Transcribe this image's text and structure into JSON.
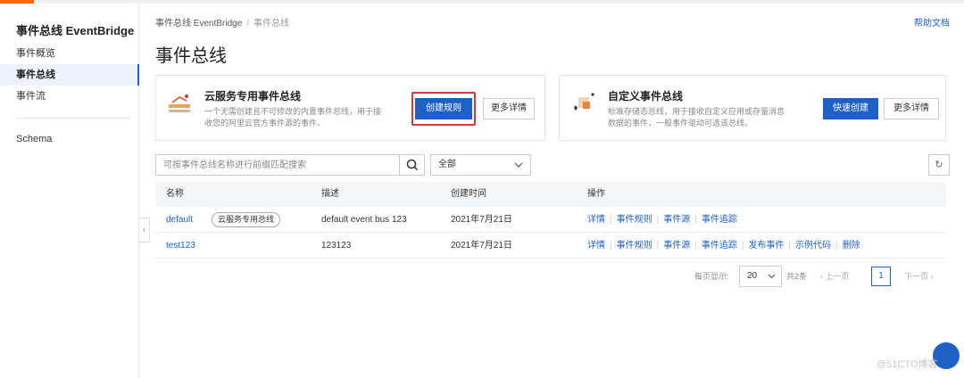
{
  "sidebar": {
    "title": "事件总线 EventBridge",
    "items": [
      {
        "label": "事件概览"
      },
      {
        "label": "事件总线"
      },
      {
        "label": "事件流"
      },
      {
        "label": "Schema"
      }
    ]
  },
  "header": {
    "breadcrumb": [
      "事件总线 EventBridge",
      "事件总线"
    ],
    "help": "帮助文档",
    "page_title": "事件总线"
  },
  "cards": [
    {
      "title": "云服务专用事件总线",
      "desc": "一个无需创建且不可修改的内置事件总线，用于接收您的阿里云官方事件源的事件。",
      "primary": "创建规则",
      "secondary": "更多详情"
    },
    {
      "title": "自定义事件总线",
      "desc": "标准存储态总线，用于接收自定义应用或存量消息数据的事件，一般事件驱动可选该总线。",
      "primary": "快速创建",
      "secondary": "更多详情"
    }
  ],
  "filter": {
    "search_placeholder": "可按事件总线名称进行前缀匹配搜索",
    "select_value": "全部"
  },
  "table": {
    "headers": [
      "名称",
      "描述",
      "创建时间",
      "操作"
    ],
    "rows": [
      {
        "name": "default",
        "tag": "云服务专用总线",
        "desc": "default event bus 123",
        "created": "2021年7月21日",
        "ops": [
          "详情",
          "事件规则",
          "事件源",
          "事件追踪"
        ]
      },
      {
        "name": "test123",
        "tag": "",
        "desc": "123123",
        "created": "2021年7月21日",
        "ops": [
          "详情",
          "事件规则",
          "事件源",
          "事件追踪",
          "发布事件",
          "示例代码",
          "删除"
        ]
      }
    ]
  },
  "pagination": {
    "per_page_label": "每页显示:",
    "per_page": "20",
    "total": "共2条",
    "prev": "上一页",
    "current": "1",
    "next": "下一页"
  },
  "watermark": "@51CTO博客",
  "colors": {
    "accent": "#ff6a00",
    "primary": "#1e60c6",
    "highlight": "#d9363e"
  }
}
